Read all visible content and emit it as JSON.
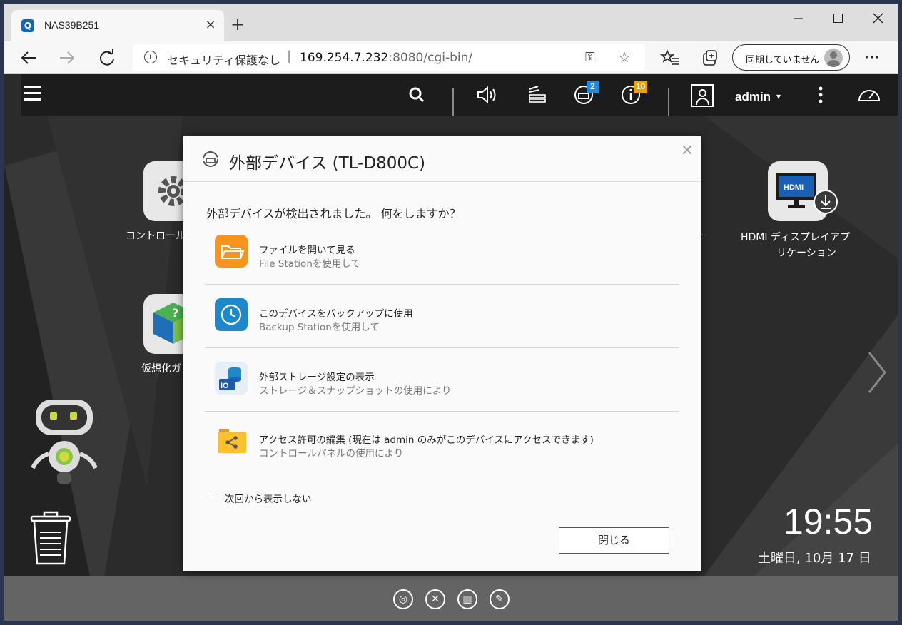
{
  "browser": {
    "tab_title": "NAS39B251",
    "tab_close": "×",
    "new_tab": "+",
    "security_label": "セキュリティ保護なし",
    "separator": "|",
    "url_host": "169.254.7.232",
    "url_rest": ":8080/cgi-bin/",
    "sync_label": "同期していません",
    "more": "⋯"
  },
  "header": {
    "user_name": "admin",
    "caret": "▾",
    "badges": {
      "background_tasks": "2",
      "notifications": "10"
    }
  },
  "desktop": {
    "apps": {
      "control_panel": "コントロール",
      "virtualization": "仮想化ガ",
      "app_right_partial": "ー",
      "hdmi_line1": "HDMI ディスプレイアプ",
      "hdmi_line2": "リケーション"
    },
    "clock": "19:55",
    "date": "土曜日, 10月 17 日"
  },
  "dialog": {
    "title": "外部デバイス (TL-D800C)",
    "close": "×",
    "prompt": "外部デバイスが検出されました。 何をしますか？",
    "options": [
      {
        "main": "ファイルを開いて見る",
        "sub": "File Stationを使用して",
        "icon": "folder-icon"
      },
      {
        "main": "このデバイスをバックアップに使用",
        "sub": "Backup Stationを使用して",
        "icon": "backup-clock-icon"
      },
      {
        "main": "外部ストレージ設定の表示",
        "sub": "ストレージ＆スナップショットの使用により",
        "icon": "storage-icon"
      },
      {
        "main": "アクセス許可の編集 (現在は admin のみがこのデバイスにアクセスできます)",
        "sub": "コントロールパネルの使用により",
        "icon": "shared-folder-icon"
      }
    ],
    "dont_show_label": "次回から表示しない",
    "dont_show_checked": false,
    "close_button": "閉じる"
  },
  "colors": {
    "header_bg": "#1c1c1c",
    "dock_bg": "#646464",
    "badge_blue": "#1e88e5",
    "badge_orange": "#f0a000",
    "folder_orange": "#f7941d",
    "backup_blue": "#1e88c8"
  }
}
